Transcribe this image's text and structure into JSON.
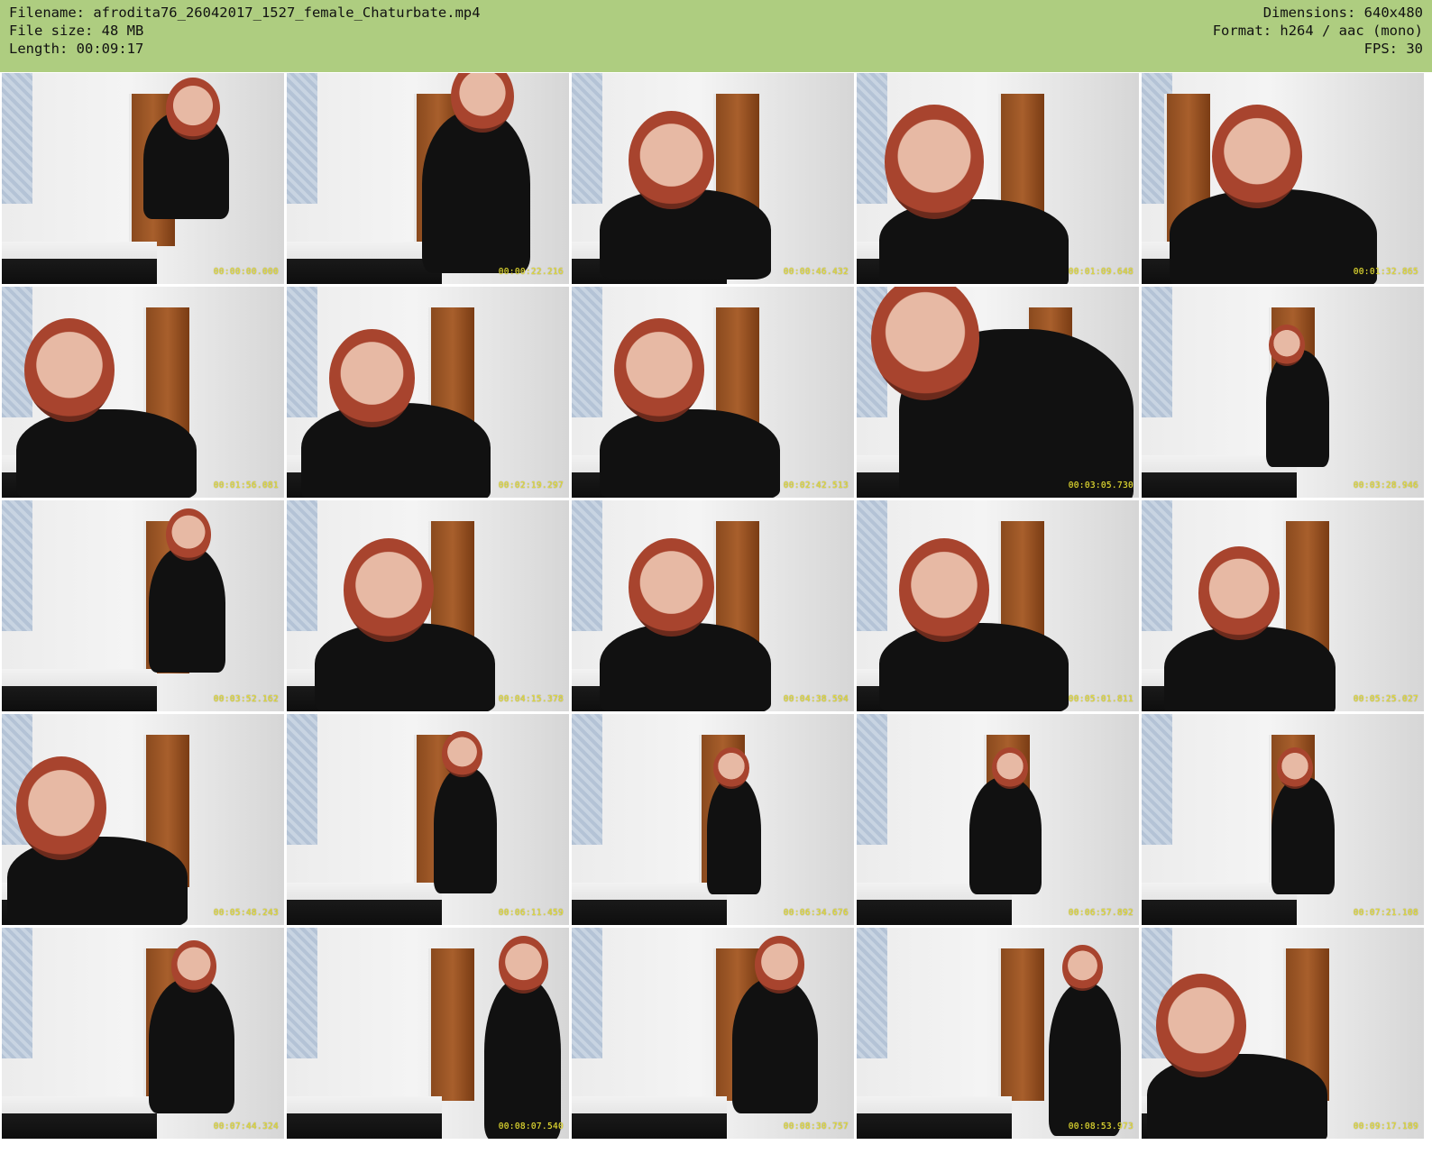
{
  "header": {
    "filename": "Filename: afrodita76_26042017_1527_female_Chaturbate.mp4",
    "file_size": "File size: 48 MB",
    "length": "Length: 00:09:17",
    "dimensions": "Dimensions: 640x480",
    "format": "Format: h264 / aac (mono)",
    "fps": "FPS: 30"
  },
  "thumbnails": [
    {
      "timestamp": "00:00:00.000"
    },
    {
      "timestamp": "00:00:22.216"
    },
    {
      "timestamp": "00:00:46.432"
    },
    {
      "timestamp": "00:01:09.648"
    },
    {
      "timestamp": "00:01:32.865"
    },
    {
      "timestamp": "00:01:56.081"
    },
    {
      "timestamp": "00:02:19.297"
    },
    {
      "timestamp": "00:02:42.513"
    },
    {
      "timestamp": "00:03:05.730"
    },
    {
      "timestamp": "00:03:28.946"
    },
    {
      "timestamp": "00:03:52.162"
    },
    {
      "timestamp": "00:04:15.378"
    },
    {
      "timestamp": "00:04:38.594"
    },
    {
      "timestamp": "00:05:01.811"
    },
    {
      "timestamp": "00:05:25.027"
    },
    {
      "timestamp": "00:05:48.243"
    },
    {
      "timestamp": "00:06:11.459"
    },
    {
      "timestamp": "00:06:34.676"
    },
    {
      "timestamp": "00:06:57.892"
    },
    {
      "timestamp": "00:07:21.108"
    },
    {
      "timestamp": "00:07:44.324"
    },
    {
      "timestamp": "00:08:07.540"
    },
    {
      "timestamp": "00:08:30.757"
    },
    {
      "timestamp": "00:08:53.973"
    },
    {
      "timestamp": "00:09:17.189"
    }
  ],
  "colors": {
    "header_bg": "#aecd80",
    "timestamp": "#e8e23a"
  }
}
